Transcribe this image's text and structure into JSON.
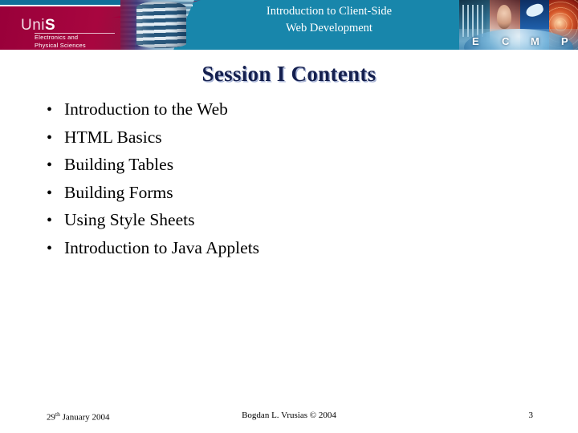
{
  "banner": {
    "title_line1": "Introduction to Client-Side",
    "title_line2": "Web Development",
    "logo": {
      "name_prefix": "Uni",
      "name_suffix": "S",
      "subtitle_line1": "Electronics and",
      "subtitle_line2": "Physical Sciences"
    },
    "montage_letters": [
      "E",
      "C",
      "M",
      "P"
    ],
    "colors": {
      "teal": "#1886ab",
      "crimson": "#a3003c",
      "white": "#ffffff"
    }
  },
  "slide": {
    "heading": "Session I Contents",
    "bullet_glyph": "•",
    "items": [
      {
        "label": "Introduction to the Web"
      },
      {
        "label": "HTML Basics"
      },
      {
        "label": "Building Tables"
      },
      {
        "label": "Building Forms"
      },
      {
        "label": "Using Style Sheets"
      },
      {
        "label": "Introduction to Java Applets"
      }
    ],
    "heading_color": "#141f4e"
  },
  "footer": {
    "date_number": "29",
    "date_ordinal": "th",
    "date_rest": " January 2004",
    "author": "Bogdan L. Vrusias © 2004",
    "page_number": "3"
  }
}
